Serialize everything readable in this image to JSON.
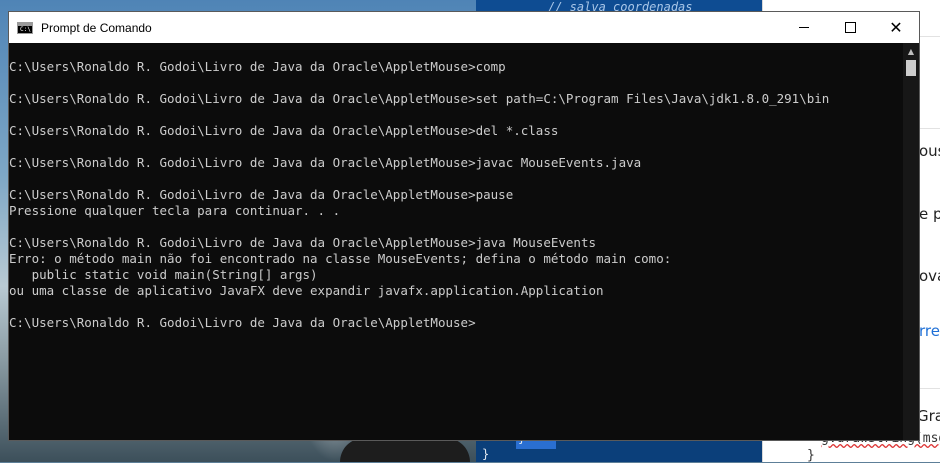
{
  "window": {
    "title": "Prompt de Comando",
    "icon": "cmd-icon",
    "icon_text": "C:\\"
  },
  "console": {
    "lines": [
      "C:\\Users\\Ronaldo R. Godoi\\Livro de Java da Oracle\\AppletMouse>comp",
      "",
      "C:\\Users\\Ronaldo R. Godoi\\Livro de Java da Oracle\\AppletMouse>set path=C:\\Program Files\\Java\\jdk1.8.0_291\\bin",
      "",
      "C:\\Users\\Ronaldo R. Godoi\\Livro de Java da Oracle\\AppletMouse>del *.class",
      "",
      "C:\\Users\\Ronaldo R. Godoi\\Livro de Java da Oracle\\AppletMouse>javac MouseEvents.java",
      "",
      "C:\\Users\\Ronaldo R. Godoi\\Livro de Java da Oracle\\AppletMouse>pause",
      "Pressione qualquer tecla para continuar. . .",
      "",
      "C:\\Users\\Ronaldo R. Godoi\\Livro de Java da Oracle\\AppletMouse>java MouseEvents",
      "Erro: o método main não foi encontrado na classe MouseEvents; defina o método main como:",
      "   public static void main(String[] args)",
      "ou uma classe de aplicativo JavaFX deve expandir javafx.application.Application",
      "",
      "C:\\Users\\Ronaldo R. Godoi\\Livro de Java da Oracle\\AppletMouse>"
    ],
    "text_color": "#cccccc",
    "background": "#0c0c0c"
  },
  "editor_background": {
    "top_line": "// salva coordenadas",
    "bottom_brace_1": "}",
    "bottom_brace_2": "}"
  },
  "side_panel": {
    "fragments": [
      "ous",
      "e p",
      "ova",
      "rren",
      "Gra",
      "g.drawString(msg",
      "}"
    ]
  }
}
